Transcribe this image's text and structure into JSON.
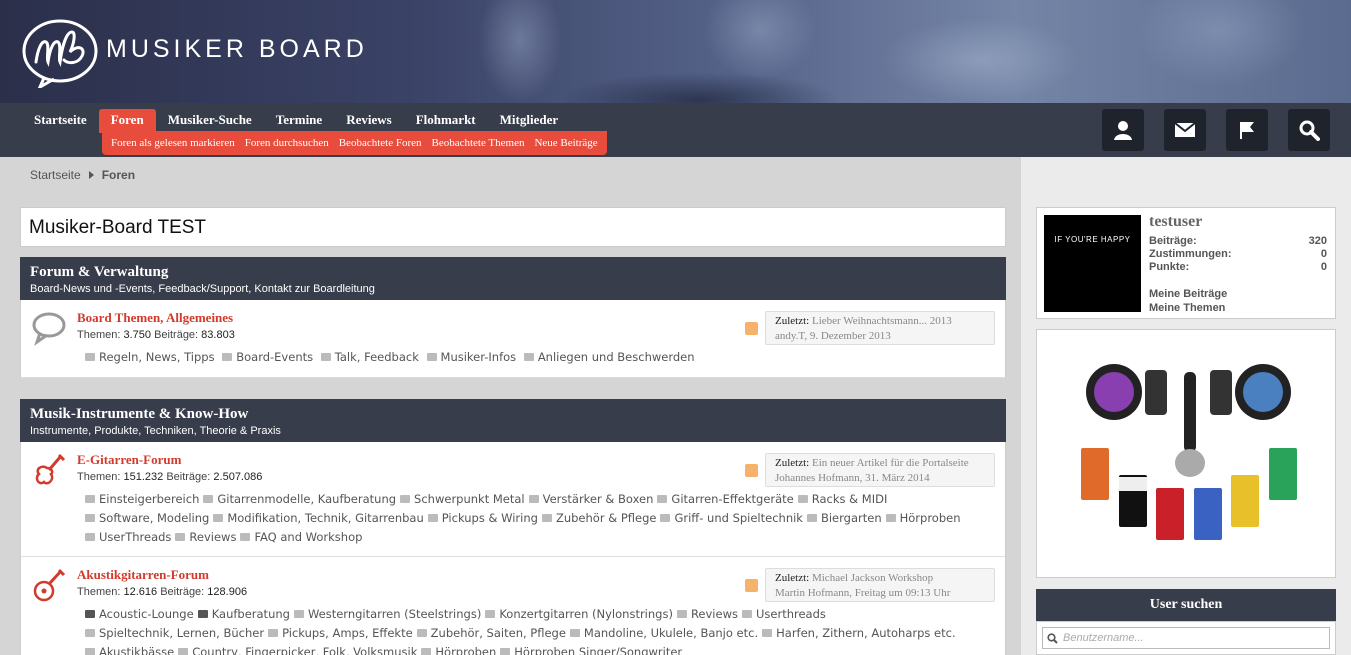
{
  "brand": {
    "name": "MUSIKER BOARD",
    "logo_letters": "mb"
  },
  "nav": {
    "tabs": [
      "Startseite",
      "Foren",
      "Musiker-Suche",
      "Termine",
      "Reviews",
      "Flohmarkt",
      "Mitglieder"
    ],
    "active_tab": "Foren",
    "subnav": [
      "Foren als gelesen markieren",
      "Foren durchsuchen",
      "Beobachtete Foren",
      "Beobachtete Themen",
      "Neue Beiträge"
    ],
    "icons": [
      "user-icon",
      "mail-icon",
      "flag-icon",
      "search-icon"
    ]
  },
  "breadcrumb": {
    "home": "Startseite",
    "current": "Foren"
  },
  "page_title": "Musiker-Board TEST",
  "categories": [
    {
      "title": "Forum & Verwaltung",
      "description": "Board-News und -Events, Feedback/Support, Kontakt zur Boardleitung",
      "forums": [
        {
          "name": "Board Themen, Allgemeines",
          "themen_label": "Themen:",
          "themen": "3.750",
          "beitraege_label": "Beiträge:",
          "beitraege": "83.803",
          "icon": "speech-bubble-icon",
          "subforums": [
            "Regeln, News, Tipps",
            "Board-Events",
            "Talk, Feedback",
            "Musiker-Infos",
            "Anliegen und Beschwerden"
          ],
          "last_label": "Zuletzt:",
          "last_title": "Lieber Weihnachtsmann... 2013",
          "last_user": "andy.T",
          "last_date": "9. Dezember 2013"
        }
      ]
    },
    {
      "title": "Musik-Instrumente & Know-How",
      "description": "Instrumente, Produkte, Techniken, Theorie & Praxis",
      "forums": [
        {
          "name": "E-Gitarren-Forum",
          "themen_label": "Themen:",
          "themen": "151.232",
          "beitraege_label": "Beiträge:",
          "beitraege": "2.507.086",
          "icon": "electric-guitar-icon",
          "subforums": [
            "Einsteigerbereich",
            "Gitarrenmodelle, Kaufberatung",
            "Schwerpunkt Metal",
            "Verstärker & Boxen",
            "Gitarren-Effektgeräte",
            "Racks & MIDI",
            "Software, Modeling",
            "Modifikation, Technik, Gitarrenbau",
            "Pickups & Wiring",
            "Zubehör & Pflege",
            "Griff- und Spieltechnik",
            "Biergarten",
            "Hörproben",
            "UserThreads",
            "Reviews",
            "FAQ and Workshop"
          ],
          "last_label": "Zuletzt:",
          "last_title": "Ein neuer Artikel für die Portalseite",
          "last_user": "Johannes Hofmann",
          "last_date": "31. März 2014"
        },
        {
          "name": "Akustikgitarren-Forum",
          "themen_label": "Themen:",
          "themen": "12.616",
          "beitraege_label": "Beiträge:",
          "beitraege": "128.906",
          "icon": "acoustic-guitar-icon",
          "subforums": [
            "Acoustic-Lounge",
            "Kaufberatung",
            "Westerngitarren (Steelstrings)",
            "Konzertgitarren (Nylonstrings)",
            "Reviews",
            "Userthreads",
            "Spieltechnik, Lernen, Bücher",
            "Pickups, Amps, Effekte",
            "Zubehör, Saiten, Pflege",
            "Mandoline, Ukulele, Banjo etc.",
            "Harfen, Zithern, Autoharps etc.",
            "Akustikbässe",
            "Country, Fingerpicker, Folk, Volksmusik",
            "Hörproben",
            "Hörproben Singer/Songwriter"
          ],
          "last_label": "Zuletzt:",
          "last_title": "Michael Jackson Workshop",
          "last_user": "Martin Hofmann",
          "last_date": "Freitag um 09:13 Uhr"
        }
      ]
    }
  ],
  "sidebar": {
    "user": {
      "name": "testuser",
      "avatar_text": "IF YOU'RE HAPPY",
      "stats": [
        {
          "label": "Beiträge:",
          "value": "320"
        },
        {
          "label": "Zustimmungen:",
          "value": "0"
        },
        {
          "label": "Punkte:",
          "value": "0"
        }
      ],
      "links": [
        "Meine Beiträge",
        "Meine Themen"
      ]
    },
    "user_search": {
      "title": "User suchen",
      "placeholder": "Benutzername..."
    }
  }
}
